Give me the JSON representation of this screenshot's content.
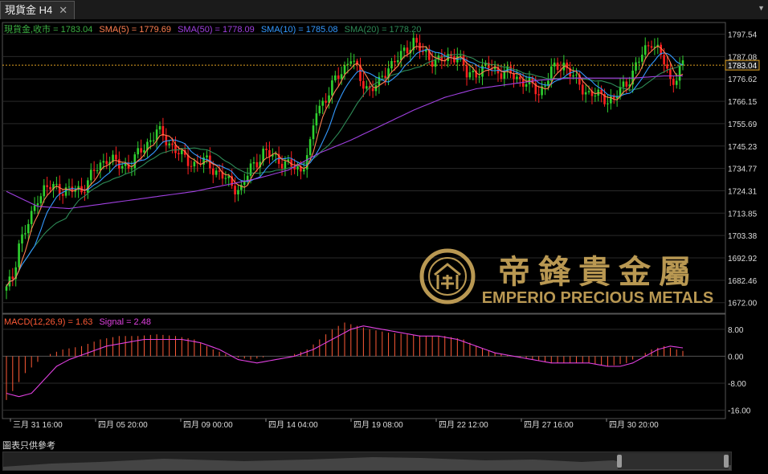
{
  "tab": {
    "title": "現貨金 H4",
    "close_icon": "close-icon",
    "menu_icon": "chevron-down-icon"
  },
  "legend": {
    "price": {
      "label": "現貨金,收市 = 1783.04",
      "color": "#3cb043"
    },
    "sma5": {
      "label": "SMA(5) = 1779.69",
      "color": "#ff7f50"
    },
    "sma50": {
      "label": "SMA(50) = 1778.09",
      "color": "#a040e0"
    },
    "sma10": {
      "label": "SMA(10) = 1785.08",
      "color": "#3399ff"
    },
    "sma20": {
      "label": "SMA(20) = 1778.20",
      "color": "#2e8b57"
    }
  },
  "macd_legend": {
    "macd": "MACD(12,26,9) = 1.63",
    "signal": "Signal = 2.48",
    "macd_color": "#ff5a36",
    "signal_color": "#e040e0"
  },
  "watermark": {
    "chinese": "帝鋒貴金屬",
    "english": "EMPERIO PRECIOUS METALS"
  },
  "footer_label": "圖表只供參考",
  "current_price_label": "1783.04",
  "chart_data": {
    "type": "candlestick",
    "price_axis": {
      "ylim": [
        1667,
        1803
      ],
      "ticks": [
        1797.54,
        1787.08,
        1776.62,
        1766.15,
        1755.69,
        1745.23,
        1734.77,
        1724.31,
        1713.85,
        1703.38,
        1692.92,
        1682.46,
        1672.0
      ]
    },
    "macd_axis": {
      "ylim": [
        -18.5,
        12.5
      ],
      "ticks": [
        8.0,
        0.0,
        -8.0,
        -16.0
      ]
    },
    "x_labels": [
      "三月 31 16:00",
      "四月 05 20:00",
      "四月 09 00:00",
      "四月 14 04:00",
      "四月 19 08:00",
      "四月 22 12:00",
      "四月 27 16:00",
      "四月 30 20:00"
    ],
    "current_price": 1783.04,
    "close_path": [
      [
        0,
        1678
      ],
      [
        2,
        1684
      ],
      [
        4,
        1700
      ],
      [
        6,
        1705
      ],
      [
        8,
        1712
      ],
      [
        10,
        1722
      ],
      [
        12,
        1725
      ],
      [
        16,
        1726
      ],
      [
        20,
        1724
      ],
      [
        24,
        1725
      ],
      [
        28,
        1733
      ],
      [
        32,
        1740
      ],
      [
        36,
        1736
      ],
      [
        40,
        1737
      ],
      [
        44,
        1745
      ],
      [
        48,
        1752
      ],
      [
        52,
        1747
      ],
      [
        56,
        1740
      ],
      [
        60,
        1737
      ],
      [
        64,
        1738
      ],
      [
        68,
        1732
      ],
      [
        72,
        1727
      ],
      [
        75,
        1725
      ],
      [
        78,
        1735
      ],
      [
        82,
        1742
      ],
      [
        86,
        1740
      ],
      [
        90,
        1736
      ],
      [
        94,
        1734
      ],
      [
        97,
        1745
      ],
      [
        99,
        1762
      ],
      [
        102,
        1768
      ],
      [
        106,
        1778
      ],
      [
        110,
        1787
      ],
      [
        113,
        1776
      ],
      [
        116,
        1772
      ],
      [
        119,
        1774
      ],
      [
        122,
        1783
      ],
      [
        126,
        1787
      ],
      [
        130,
        1795
      ],
      [
        133,
        1788
      ],
      [
        136,
        1786
      ],
      [
        140,
        1785
      ],
      [
        144,
        1789
      ],
      [
        147,
        1778
      ],
      [
        150,
        1780
      ],
      [
        154,
        1782
      ],
      [
        158,
        1780
      ],
      [
        162,
        1778
      ],
      [
        166,
        1775
      ],
      [
        170,
        1770
      ],
      [
        174,
        1780
      ],
      [
        178,
        1784
      ],
      [
        182,
        1775
      ],
      [
        186,
        1770
      ],
      [
        190,
        1768
      ],
      [
        194,
        1767
      ],
      [
        198,
        1775
      ],
      [
        202,
        1785
      ],
      [
        206,
        1795
      ],
      [
        208,
        1790
      ],
      [
        210,
        1784
      ],
      [
        212,
        1776
      ],
      [
        214,
        1778
      ],
      [
        216,
        1783
      ]
    ],
    "sma50_path": [
      [
        0,
        1724
      ],
      [
        10,
        1717
      ],
      [
        20,
        1716
      ],
      [
        30,
        1718
      ],
      [
        40,
        1720
      ],
      [
        50,
        1722
      ],
      [
        60,
        1724
      ],
      [
        70,
        1727
      ],
      [
        80,
        1730
      ],
      [
        90,
        1734
      ],
      [
        100,
        1742
      ],
      [
        110,
        1748
      ],
      [
        120,
        1755
      ],
      [
        130,
        1762
      ],
      [
        140,
        1768
      ],
      [
        150,
        1772
      ],
      [
        160,
        1774
      ],
      [
        170,
        1776
      ],
      [
        180,
        1777
      ],
      [
        190,
        1777
      ],
      [
        200,
        1777
      ],
      [
        210,
        1778
      ],
      [
        216,
        1778
      ]
    ],
    "macd_path": [
      [
        0,
        -13
      ],
      [
        6,
        -5
      ],
      [
        12,
        0
      ],
      [
        18,
        2
      ],
      [
        24,
        3
      ],
      [
        30,
        5
      ],
      [
        36,
        6
      ],
      [
        42,
        6
      ],
      [
        48,
        6.5
      ],
      [
        54,
        6
      ],
      [
        60,
        5
      ],
      [
        66,
        2
      ],
      [
        72,
        0
      ],
      [
        78,
        -1
      ],
      [
        84,
        0
      ],
      [
        90,
        0
      ],
      [
        96,
        2
      ],
      [
        100,
        5
      ],
      [
        104,
        8
      ],
      [
        108,
        10
      ],
      [
        112,
        9
      ],
      [
        116,
        8
      ],
      [
        122,
        7
      ],
      [
        128,
        6.5
      ],
      [
        134,
        6
      ],
      [
        140,
        6
      ],
      [
        146,
        5
      ],
      [
        150,
        3
      ],
      [
        156,
        1
      ],
      [
        162,
        0
      ],
      [
        168,
        -1
      ],
      [
        174,
        -2
      ],
      [
        180,
        -2
      ],
      [
        186,
        -2
      ],
      [
        192,
        -3
      ],
      [
        198,
        -2
      ],
      [
        202,
        0
      ],
      [
        206,
        2
      ],
      [
        210,
        3
      ],
      [
        214,
        2
      ],
      [
        216,
        1.6
      ]
    ],
    "signal_path": [
      [
        0,
        -11
      ],
      [
        4,
        -12
      ],
      [
        8,
        -11
      ],
      [
        12,
        -7
      ],
      [
        16,
        -3
      ],
      [
        20,
        -1
      ],
      [
        26,
        1
      ],
      [
        32,
        3
      ],
      [
        38,
        4
      ],
      [
        44,
        5
      ],
      [
        50,
        5
      ],
      [
        56,
        5
      ],
      [
        62,
        4
      ],
      [
        68,
        2
      ],
      [
        74,
        -1
      ],
      [
        80,
        -2
      ],
      [
        86,
        -1
      ],
      [
        92,
        0
      ],
      [
        98,
        2
      ],
      [
        104,
        5
      ],
      [
        110,
        8
      ],
      [
        114,
        9
      ],
      [
        120,
        8
      ],
      [
        126,
        7
      ],
      [
        132,
        6
      ],
      [
        138,
        6
      ],
      [
        144,
        5
      ],
      [
        150,
        3
      ],
      [
        156,
        1
      ],
      [
        162,
        0
      ],
      [
        168,
        -1
      ],
      [
        174,
        -2
      ],
      [
        180,
        -2
      ],
      [
        186,
        -2
      ],
      [
        192,
        -3
      ],
      [
        196,
        -3
      ],
      [
        200,
        -2
      ],
      [
        204,
        0
      ],
      [
        208,
        2
      ],
      [
        212,
        3
      ],
      [
        216,
        2.48
      ]
    ]
  }
}
